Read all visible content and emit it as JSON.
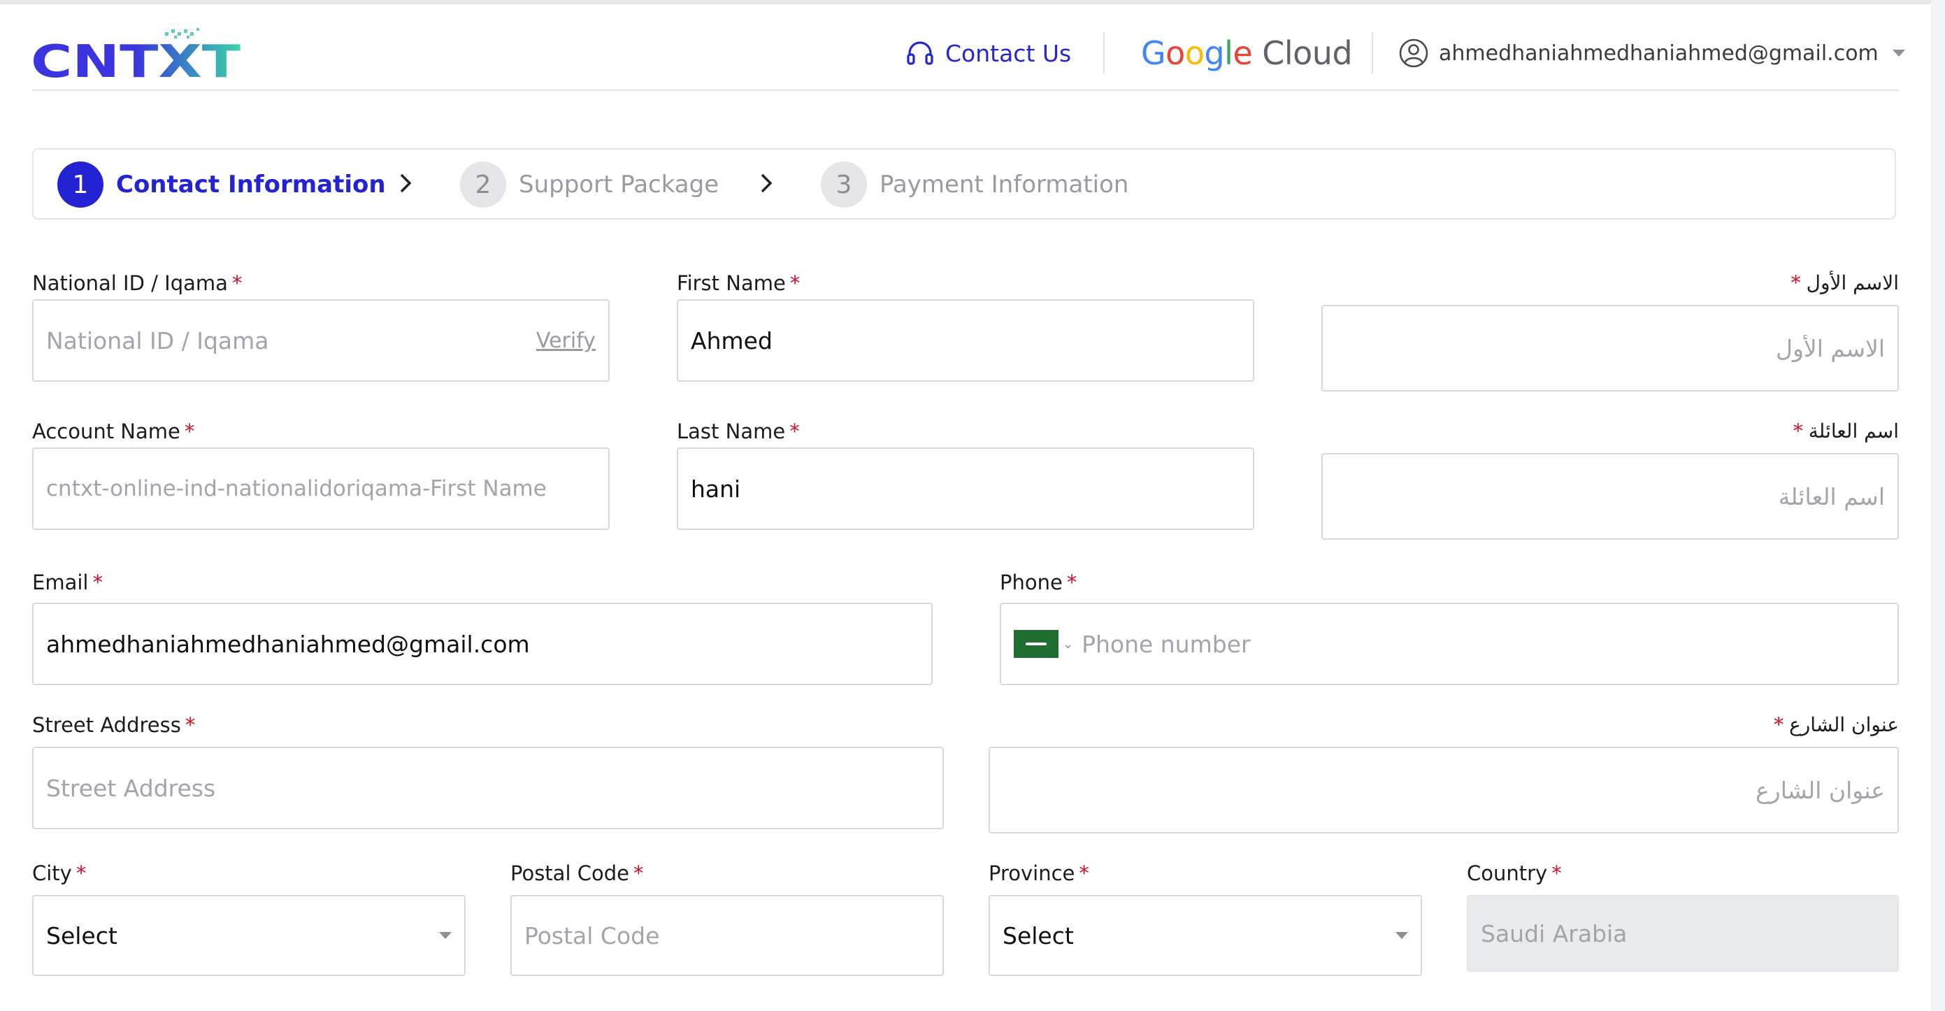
{
  "header": {
    "logo_text": "CNTXT",
    "contact_label": "Contact Us",
    "google_word": [
      "G",
      "o",
      "o",
      "g",
      "l",
      "e"
    ],
    "google_colors": [
      "#4285F4",
      "#EA4335",
      "#FBBC05",
      "#4285F4",
      "#34A853",
      "#EA4335"
    ],
    "cloud_word": "Cloud",
    "user_email": "ahmedhaniahmedhaniahmed@gmail.com",
    "icons": {
      "contact": "headset-icon",
      "user": "user-circle-icon",
      "menu": "caret-down-icon"
    }
  },
  "stepper": {
    "steps": [
      {
        "number": "1",
        "label": "Contact Information",
        "state": "active"
      },
      {
        "number": "2",
        "label": "Support Package",
        "state": "inactive"
      },
      {
        "number": "3",
        "label": "Payment Information",
        "state": "inactive"
      }
    ],
    "separator_icon": "chevron-right-icon"
  },
  "form": {
    "required_mark": "*",
    "national_id": {
      "label": "National ID / Iqama",
      "placeholder": "National ID / Iqama",
      "action": "Verify"
    },
    "first_name": {
      "label": "First Name",
      "value": "Ahmed"
    },
    "first_name_ar": {
      "label": "الاسم الأول",
      "placeholder": "الاسم الأول"
    },
    "account_name": {
      "label": "Account Name",
      "value": "cntxt-online-ind-nationalidoriqama-First Name"
    },
    "last_name": {
      "label": "Last Name",
      "value": "hani"
    },
    "last_name_ar": {
      "label": "اسم العائلة",
      "placeholder": "اسم العائلة"
    },
    "email": {
      "label": "Email",
      "value": "ahmedhaniahmedhaniahmed@gmail.com"
    },
    "phone": {
      "label": "Phone",
      "placeholder": "Phone number",
      "country_flag": "saudi-arabia-flag-icon"
    },
    "street": {
      "label": "Street Address",
      "placeholder": "Street Address"
    },
    "street_ar": {
      "label": "عنوان الشارع",
      "placeholder": "عنوان الشارع"
    },
    "city": {
      "label": "City",
      "value": "Select"
    },
    "postal_code": {
      "label": "Postal Code",
      "placeholder": "Postal Code"
    },
    "province": {
      "label": "Province",
      "value": "Select"
    },
    "country": {
      "label": "Country",
      "value": "Saudi Arabia"
    }
  },
  "colors": {
    "accent": "#2323d4",
    "required": "#d4102a",
    "logo_blue": "#3a35e0",
    "logo_teal": "#38d6a8"
  }
}
